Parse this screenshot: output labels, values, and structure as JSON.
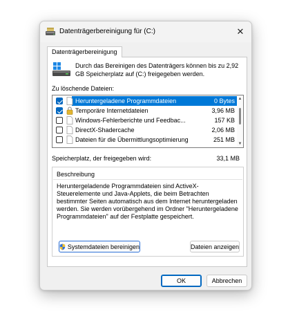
{
  "window": {
    "title": "Datenträgerbereinigung für  (C:)",
    "close_label": "✕"
  },
  "tab": {
    "label": "Datenträgerbereinigung"
  },
  "intro": {
    "text": "Durch das Bereinigen des Datenträgers können bis zu 2,92 GB Speicherplatz auf  (C:) freigegeben werden."
  },
  "list": {
    "label": "Zu löschende Dateien:",
    "items": [
      {
        "name": "Heruntergeladene Programmdateien",
        "size": "0 Bytes",
        "checked": true,
        "selected": true
      },
      {
        "name": "Temporäre Internetdateien",
        "size": "3,96 MB",
        "checked": true,
        "selected": false
      },
      {
        "name": "Windows-Fehlerberichte und Feedbac...",
        "size": "157 KB",
        "checked": false,
        "selected": false
      },
      {
        "name": "DirectX-Shadercache",
        "size": "2,06 MB",
        "checked": false,
        "selected": false
      },
      {
        "name": "Dateien für die Übermittlungsoptimierung",
        "size": "251 MB",
        "checked": false,
        "selected": false
      }
    ]
  },
  "space": {
    "label": "Speicherplatz, der freigegeben wird:",
    "value": "33,1 MB"
  },
  "description": {
    "title": "Beschreibung",
    "text": "Heruntergeladende Programmdateien sind ActiveX-Steuerelemente und Java-Applets, die beim Betrachten bestimmter Seiten automatisch aus dem Internet heruntergeladen werden. Sie werden vorübergehend im Ordner \"Heruntergeladene Programmdateien\" auf der Festplatte gespeichert."
  },
  "buttons": {
    "clean_system": "Systemdateien bereinigen",
    "show_files": "Dateien anzeigen",
    "ok": "OK",
    "cancel": "Abbrechen"
  },
  "colors": {
    "selection": "#0078d7",
    "checkbox": "#0067c0",
    "window_bg": "#f0f0f0"
  }
}
